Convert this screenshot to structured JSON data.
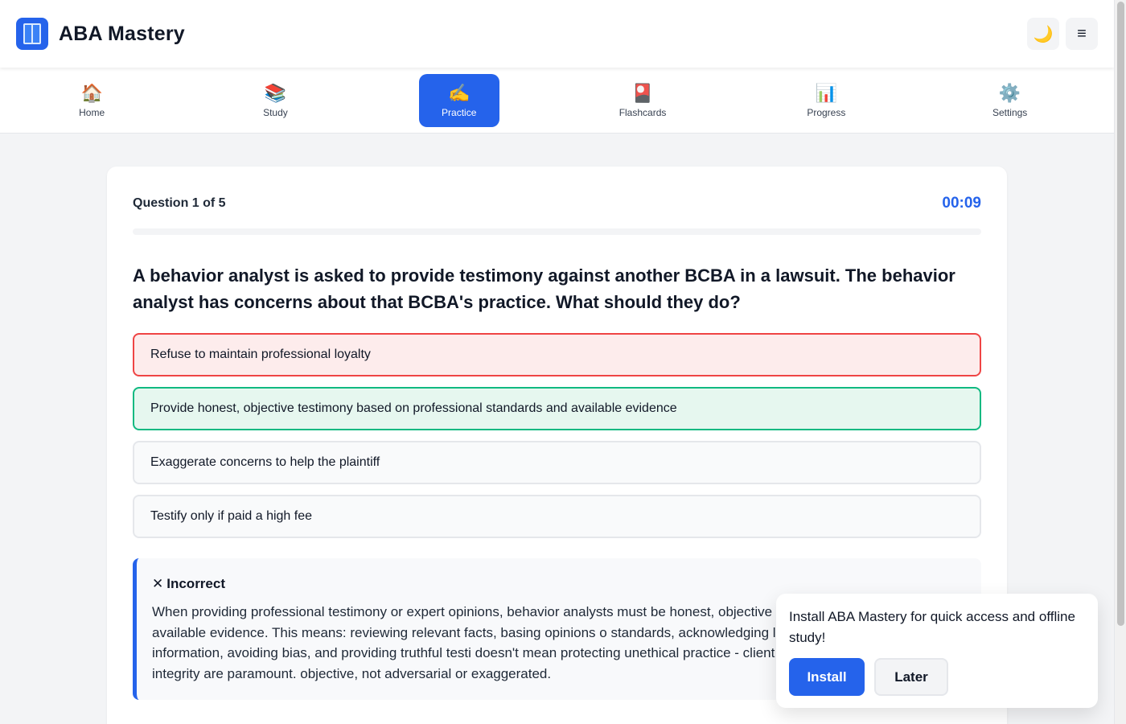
{
  "app": {
    "title": "ABA Mastery",
    "logo_icon": "book-icon",
    "theme_toggle_icon": "🌙",
    "menu_icon": "≡"
  },
  "nav": {
    "items": [
      {
        "label": "Home",
        "icon": "🏠",
        "active": false
      },
      {
        "label": "Study",
        "icon": "📚",
        "active": false
      },
      {
        "label": "Practice",
        "icon": "✍️",
        "active": true
      },
      {
        "label": "Flashcards",
        "icon": "🎴",
        "active": false
      },
      {
        "label": "Progress",
        "icon": "📊",
        "active": false
      },
      {
        "label": "Settings",
        "icon": "⚙️",
        "active": false
      }
    ]
  },
  "quiz": {
    "counter": "Question 1 of 5",
    "timer": "00:09",
    "progress_fraction": 0,
    "question": "A behavior analyst is asked to provide testimony against another BCBA in a lawsuit. The behavior analyst has concerns about that BCBA's practice. What should they do?",
    "options": [
      {
        "text": "Refuse to maintain professional loyalty",
        "state": "incorrect"
      },
      {
        "text": "Provide honest, objective testimony based on professional standards and available evidence",
        "state": "correct"
      },
      {
        "text": "Exaggerate concerns to help the plaintiff",
        "state": "neutral"
      },
      {
        "text": "Testify only if paid a high fee",
        "state": "neutral"
      }
    ],
    "feedback": {
      "icon": "✕",
      "title": "Incorrect",
      "text": "When providing professional testimony or expert opinions, behavior analysts must be honest, objective professional standards and available evidence. This means: reviewing relevant facts, basing opinions o standards, acknowledging limitations of available information, avoiding bias, and providing truthful testi doesn't mean protecting unethical practice - client protection and professional integrity are paramount. objective, not adversarial or exaggerated."
    }
  },
  "install_prompt": {
    "text": "Install ABA Mastery for quick access and offline study!",
    "install_label": "Install",
    "later_label": "Later"
  },
  "colors": {
    "accent": "#2563eb",
    "incorrect": "#ef4444",
    "correct": "#10b981"
  }
}
